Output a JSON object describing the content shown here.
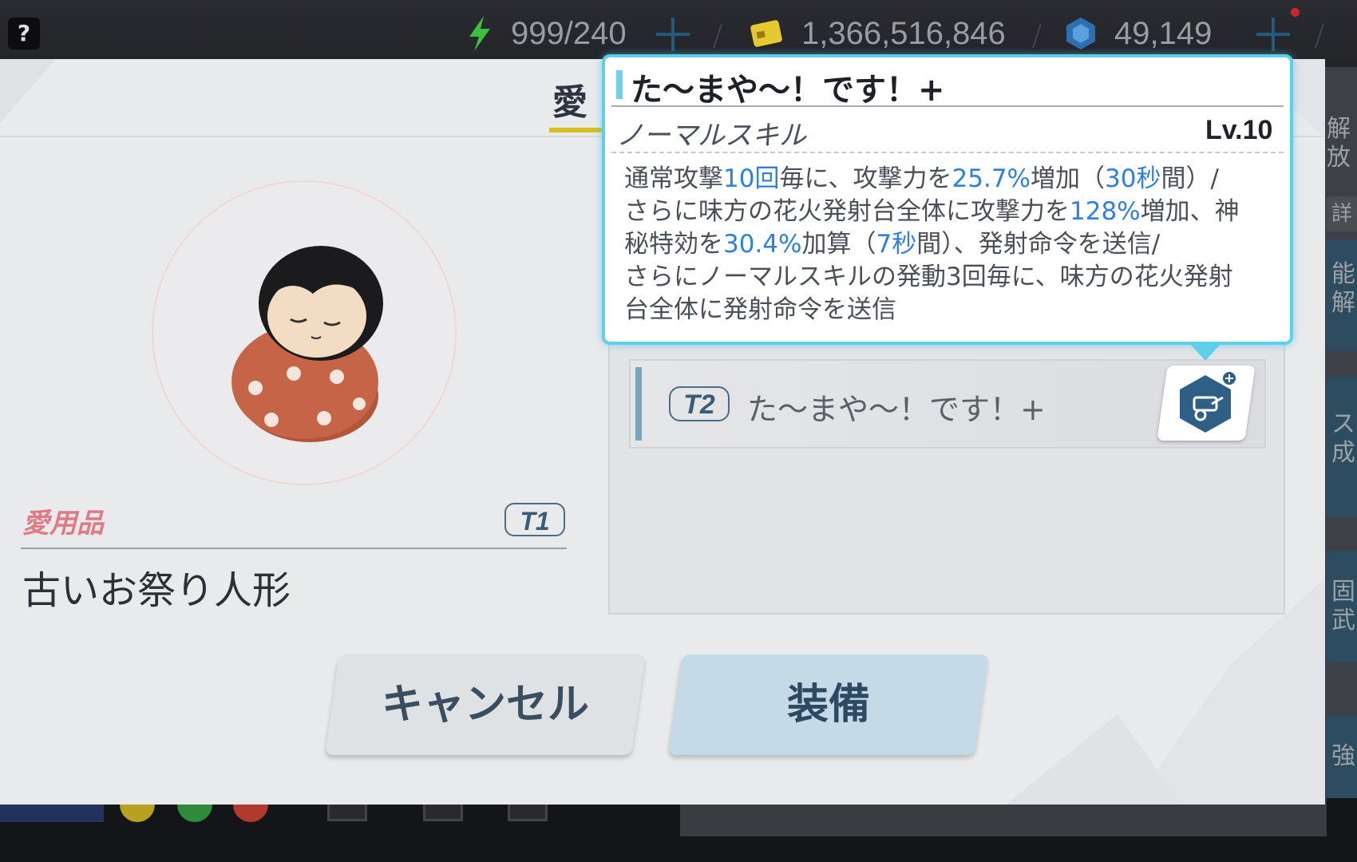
{
  "topbar": {
    "help_label": "?",
    "stamina": "999/240",
    "credits": "1,366,516,846",
    "gems": "49,149",
    "colors": {
      "stamina_icon": "#3fbf3f",
      "credits_icon": "#e6c832",
      "gems_icon": "#2d6fb0",
      "plus": "#235a80",
      "notification": "#c8262c"
    }
  },
  "right_strip": {
    "items": [
      "解放",
      "詳",
      "能\n解",
      "ス\n成",
      "固\n武",
      "強"
    ]
  },
  "dialog": {
    "title_fragment": "愛",
    "item": {
      "label": "愛用品",
      "tier": "T1",
      "name": "古いお祭り人形"
    },
    "skill_row": {
      "tier": "T2",
      "name": "た〜まや〜！です！+"
    },
    "buttons": {
      "cancel": "キャンセル",
      "equip": "装備"
    }
  },
  "tooltip": {
    "title": "た〜まや〜！です！+",
    "skill_type": "ノーマルスキル",
    "level": "Lv.10",
    "description": [
      [
        {
          "t": "通常攻撃"
        },
        {
          "t": "10回",
          "hl": true
        },
        {
          "t": "毎に、攻撃力を"
        },
        {
          "t": "25.7%",
          "hl": true
        },
        {
          "t": "増加（"
        },
        {
          "t": "30秒",
          "hl": true
        },
        {
          "t": "間）/"
        }
      ],
      [
        {
          "t": "さらに味方の花火発射台全体に攻撃力を"
        },
        {
          "t": "128%",
          "hl": true
        },
        {
          "t": "増加、神"
        }
      ],
      [
        {
          "t": "秘特効を"
        },
        {
          "t": "30.4%",
          "hl": true
        },
        {
          "t": "加算（"
        },
        {
          "t": "7秒",
          "hl": true
        },
        {
          "t": "間）、発射命令を送信/"
        }
      ],
      [
        {
          "t": "さらにノーマルスキルの発動3回毎に、味方の花火発射"
        }
      ],
      [
        {
          "t": "台全体に発射命令を送信"
        }
      ]
    ],
    "colors": {
      "border": "#5fd0ec",
      "highlight": "#2f7fe0"
    }
  }
}
